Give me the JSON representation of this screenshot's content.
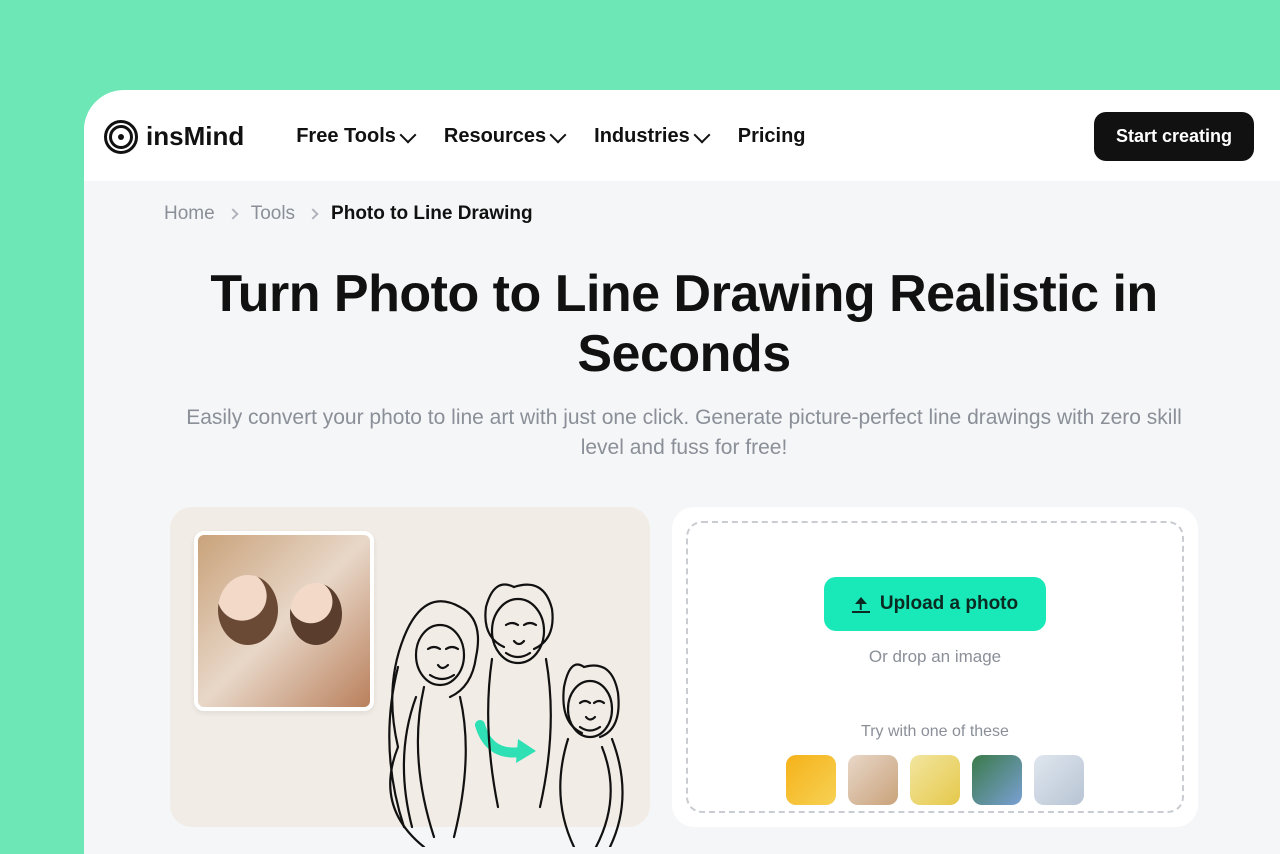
{
  "header": {
    "brand": "insMind",
    "nav": {
      "free_tools": "Free Tools",
      "resources": "Resources",
      "industries": "Industries",
      "pricing": "Pricing"
    },
    "cta": "Start creating"
  },
  "breadcrumb": {
    "home": "Home",
    "tools": "Tools",
    "current": "Photo to Line Drawing"
  },
  "hero": {
    "title": "Turn Photo to Line Drawing Realistic in Seconds",
    "subtitle": "Easily convert your photo to line art with just one click. Generate picture-perfect line drawings with zero skill level and fuss for free!"
  },
  "uploader": {
    "button": "Upload a photo",
    "drop": "Or drop an image",
    "try": "Try with one of these",
    "samples": [
      {
        "name": "sample-person-yellow"
      },
      {
        "name": "sample-couple"
      },
      {
        "name": "sample-product-yellow"
      },
      {
        "name": "sample-landscape"
      },
      {
        "name": "sample-woman-grey"
      }
    ]
  },
  "preview": {
    "photo_alt": "family photo",
    "lineart_alt": "line drawing output"
  },
  "colors": {
    "accent": "#19e8b8",
    "bg": "#6ee7b7"
  }
}
